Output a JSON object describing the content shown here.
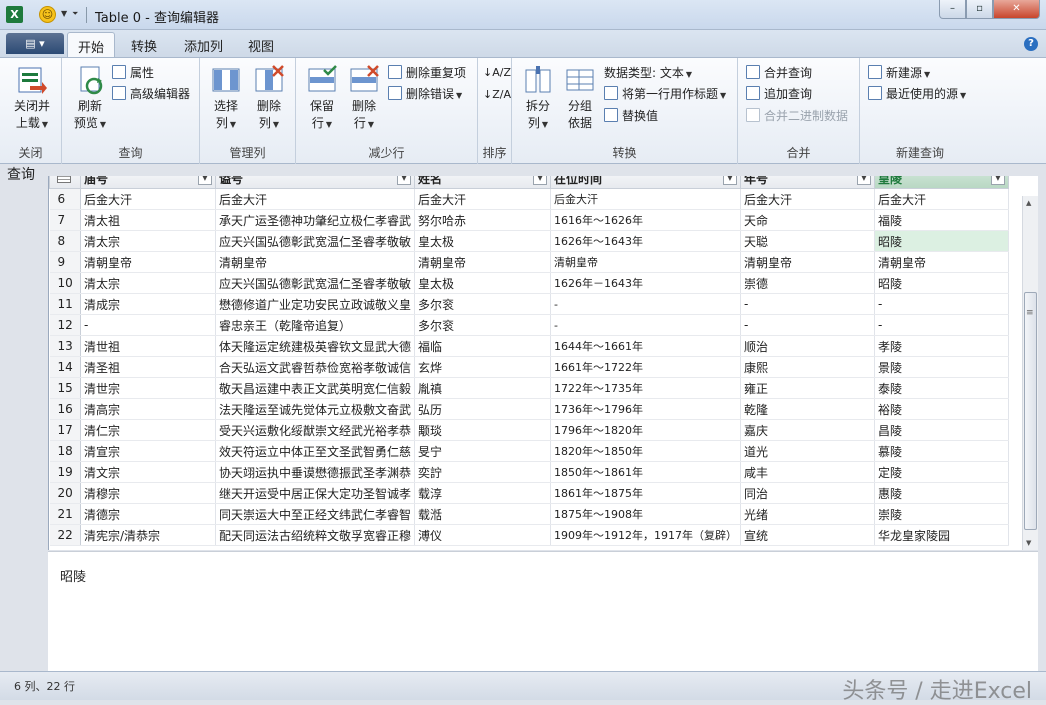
{
  "window": {
    "app_icon": "excel-icon",
    "title": "Table 0 - 查询编辑器",
    "controls": {
      "minimize": "–",
      "maximize": "▫",
      "close": "✕"
    }
  },
  "tabs": {
    "file": "▤ ▾",
    "items": [
      "开始",
      "转换",
      "添加列",
      "视图"
    ],
    "active": 0,
    "help": "?"
  },
  "ribbon": {
    "groups": {
      "close": {
        "label": "关闭",
        "close_load": [
          "关闭并",
          "上载"
        ]
      },
      "query": {
        "label": "查询",
        "refresh": [
          "刷新",
          "预览"
        ],
        "properties": "属性",
        "advanced_editor": "高级编辑器"
      },
      "manage_columns": {
        "label": "管理列",
        "choose": [
          "选择",
          "列"
        ],
        "remove": [
          "删除",
          "列"
        ]
      },
      "reduce_rows": {
        "label": "减少行",
        "keep": [
          "保留",
          "行"
        ],
        "remove": [
          "删除",
          "行"
        ],
        "remove_duplicates": "删除重复项",
        "remove_errors": "删除错误"
      },
      "sort": {
        "label": "排序",
        "asc": "↓A/Z",
        "desc": "↓Z/A"
      },
      "transform": {
        "label": "转换",
        "split": [
          "拆分",
          "列"
        ],
        "group_by": [
          "分组",
          "依据"
        ],
        "data_type": "数据类型: 文本",
        "first_row_header": "将第一行用作标题",
        "replace_values": "替换值"
      },
      "combine": {
        "label": "合并",
        "merge": "合并查询",
        "append": "追加查询",
        "combine_binaries": "合并二进制数据"
      },
      "new_query": {
        "label": "新建查询",
        "new_source": "新建源",
        "recent_sources": "最近使用的源"
      }
    }
  },
  "side_label": "查询",
  "grid": {
    "columns": [
      "庙号",
      "谥号",
      "姓名",
      "在位时间",
      "年号",
      "皇陵"
    ],
    "selected_column": 5,
    "highlight_row": 2,
    "rows": [
      [
        "6",
        "后金大汗",
        "后金大汗",
        "后金大汗",
        "后金大汗",
        "后金大汗",
        "后金大汗"
      ],
      [
        "7",
        "清太祖",
        "承天广运圣德神功肇纪立极仁孝睿武",
        "努尔哈赤",
        "1616年～1626年",
        "天命",
        "福陵"
      ],
      [
        "8",
        "清太宗",
        "应天兴国弘德彰武宽温仁圣睿孝敬敏",
        "皇太极",
        "1626年～1643年",
        "天聪",
        "昭陵"
      ],
      [
        "9",
        "清朝皇帝",
        "清朝皇帝",
        "清朝皇帝",
        "清朝皇帝",
        "清朝皇帝",
        "清朝皇帝"
      ],
      [
        "10",
        "清太宗",
        "应天兴国弘德彰武宽温仁圣睿孝敬敏",
        "皇太极",
        "1626年－1643年",
        "崇德",
        "昭陵"
      ],
      [
        "11",
        "清成宗",
        "懋德修道广业定功安民立政诚敬义皇",
        "多尔衮",
        "-",
        "-",
        "-"
      ],
      [
        "12",
        "-",
        "睿忠亲王（乾隆帝追复）",
        "多尔衮",
        "-",
        "-",
        "-"
      ],
      [
        "13",
        "清世祖",
        "体天隆运定统建极英睿钦文显武大德",
        "福临",
        "1644年～1661年",
        "顺治",
        "孝陵"
      ],
      [
        "14",
        "清圣祖",
        "合天弘运文武睿哲恭俭宽裕孝敬诚信",
        "玄烨",
        "1661年～1722年",
        "康熙",
        "景陵"
      ],
      [
        "15",
        "清世宗",
        "敬天昌运建中表正文武英明宽仁信毅",
        "胤禛",
        "1722年～1735年",
        "雍正",
        "泰陵"
      ],
      [
        "16",
        "清高宗",
        "法天隆运至诚先觉体元立极敷文奋武",
        "弘历",
        "1736年～1796年",
        "乾隆",
        "裕陵"
      ],
      [
        "17",
        "清仁宗",
        "受天兴运敷化绥猷崇文经武光裕孝恭",
        "颙琰",
        "1796年～1820年",
        "嘉庆",
        "昌陵"
      ],
      [
        "18",
        "清宣宗",
        "效天符运立中体正至文圣武智勇仁慈",
        "旻宁",
        "1820年～1850年",
        "道光",
        "慕陵"
      ],
      [
        "19",
        "清文宗",
        "协天翊运执中垂谟懋德振武圣孝渊恭",
        "奕詝",
        "1850年～1861年",
        "咸丰",
        "定陵"
      ],
      [
        "20",
        "清穆宗",
        "继天开运受中居正保大定功圣智诚孝",
        "载淳",
        "1861年～1875年",
        "同治",
        "惠陵"
      ],
      [
        "21",
        "清德宗",
        "同天崇运大中至正经文纬武仁孝睿智",
        "载湉",
        "1875年～1908年",
        "光绪",
        "崇陵"
      ],
      [
        "22",
        "清宪宗/清恭宗",
        "配天同运法古绍统粹文敬孚宽睿正穆",
        "溥仪",
        "1909年～1912年，1917年（复辟）",
        "宣统",
        "华龙皇家陵园"
      ]
    ]
  },
  "preview": {
    "value": "昭陵"
  },
  "status": {
    "text": "6 列、22 行"
  },
  "watermark": "头条号 / 走进Excel",
  "colors": {
    "selected_column_text": "#1e7a3c",
    "highlight_cell": "#dcf0e2",
    "excel_green": "#1e7a3c"
  }
}
